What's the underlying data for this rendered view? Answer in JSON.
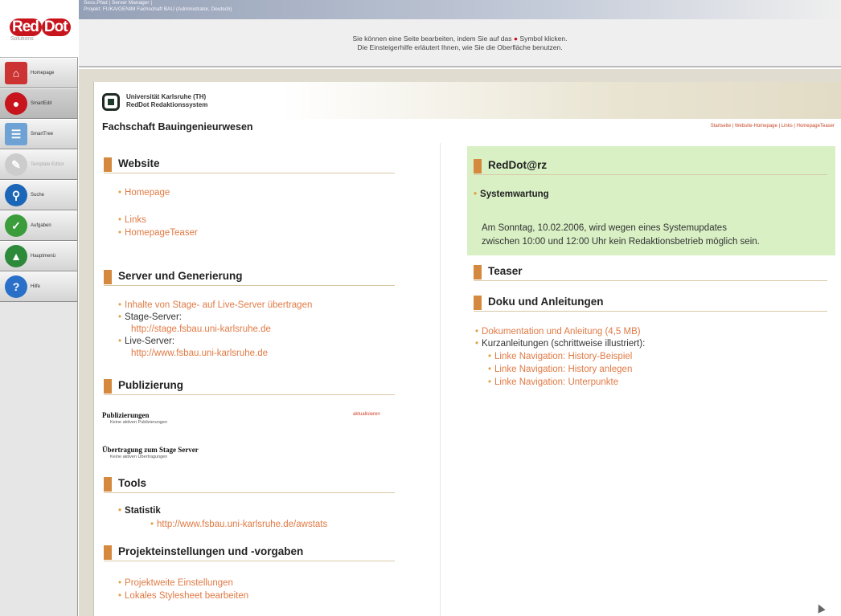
{
  "app": {
    "logo_text": "Red",
    "logo_dot": "Dot",
    "logo_sub": "Solutions",
    "header_line1": "Sess.Pfad | Server Manager |",
    "header_line2": "Projekt: FUKA/GENIM Fachschaft BAU (Administrator, Deutsch)",
    "hint_line1": "Sie können eine Seite bearbeiten, indem Sie auf das",
    "hint_line1b": "Symbol klicken.",
    "hint_line2": "Die Einsteigerhilfe erläutert Ihnen, wie Sie die Oberfläche benutzen."
  },
  "sidebar": {
    "items": [
      {
        "label": "Homepage"
      },
      {
        "label": "SmartEdit"
      },
      {
        "label": "SmartTree"
      },
      {
        "label": "Template Editor"
      },
      {
        "label": "Suche"
      },
      {
        "label": "Aufgaben"
      },
      {
        "label": "Hauptmenü"
      },
      {
        "label": "Hilfe"
      }
    ]
  },
  "page": {
    "uni_line1": "Universität Karlsruhe (TH)",
    "uni_line2": "RedDot Redaktionssystem",
    "site_title": "Fachschaft Bauingenieurwesen",
    "breadcrumb": "Startseite | Website-Homepage | Links | HomepageTeaser"
  },
  "left": {
    "website": {
      "title": "Website",
      "links": [
        "Homepage",
        "Links",
        "HomepageTeaser"
      ]
    },
    "server": {
      "title": "Server und Generierung",
      "transfer": "Inhalte von Stage- auf Live-Server übertragen",
      "stage_label": "Stage-Server:",
      "stage_url": "http://stage.fsbau.uni-karlsruhe.de",
      "live_label": "Live-Server:",
      "live_url": "http://www.fsbau.uni-karlsruhe.de"
    },
    "pub": {
      "title": "Publizierung",
      "h1": "Publizierungen",
      "h1_action": "aktualisieren",
      "h1_sub": "Keine aktiven Publizierungen",
      "h2": "Übertragung zum Stage Server",
      "h2_sub": "Keine aktiven Übertragungen"
    },
    "tools": {
      "title": "Tools",
      "stat": "Statistik",
      "stat_url": "http://www.fsbau.uni-karlsruhe.de/awstats"
    },
    "proj": {
      "title": "Projekteinstellungen und -vorgaben",
      "links": [
        "Projektweite Einstellungen",
        "Lokales Stylesheet bearbeiten"
      ]
    }
  },
  "right": {
    "rd": {
      "title": "RedDot@rz",
      "item": "Systemwartung",
      "msg1": "Am Sonntag, 10.02.2006, wird wegen eines Systemupdates",
      "msg2": "zwischen 10:00 und 12:00 Uhr kein Redaktionsbetrieb möglich sein."
    },
    "teaser": {
      "title": "Teaser"
    },
    "doku": {
      "title": "Doku und Anleitungen",
      "doc": "Dokumentation und Anleitung (4,5 MB)",
      "kurz": "Kurzanleitungen (schrittweise illustriert):",
      "subs": [
        "Linke Navigation: History-Beispiel",
        "Linke Navigation: History anlegen",
        "Linke Navigation: Unterpunkte"
      ]
    }
  }
}
